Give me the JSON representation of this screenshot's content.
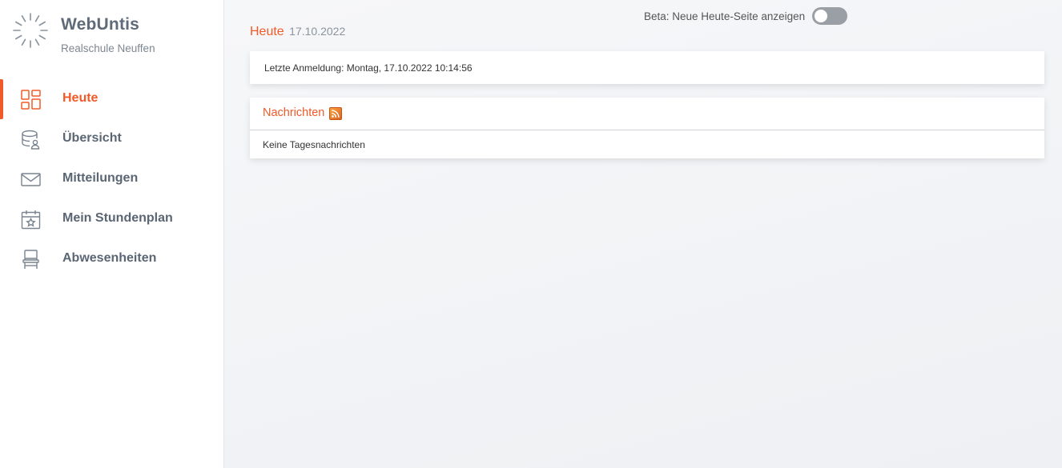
{
  "sidebar": {
    "brand_title": "WebUntis",
    "brand_subtitle": "Realschule Neuffen",
    "items": [
      {
        "label": "Heute",
        "icon": "dashboard-icon",
        "active": true
      },
      {
        "label": "Übersicht",
        "icon": "database-user-icon",
        "active": false
      },
      {
        "label": "Mitteilungen",
        "icon": "envelope-icon",
        "active": false
      },
      {
        "label": "Mein Stundenplan",
        "icon": "calendar-star-icon",
        "active": false
      },
      {
        "label": "Abwesenheiten",
        "icon": "chair-icon",
        "active": false
      }
    ]
  },
  "header": {
    "beta_label": "Beta: Neue Heute-Seite anzeigen",
    "beta_enabled": false,
    "title": "Heute",
    "date": "17.10.2022"
  },
  "login_card": {
    "text": "Letzte Anmeldung: Montag, 17.10.2022 10:14:56"
  },
  "news_card": {
    "title": "Nachrichten",
    "empty_text": "Keine Tagesnachrichten"
  },
  "colors": {
    "accent": "#f05a28",
    "nav_text": "#5b6674"
  }
}
